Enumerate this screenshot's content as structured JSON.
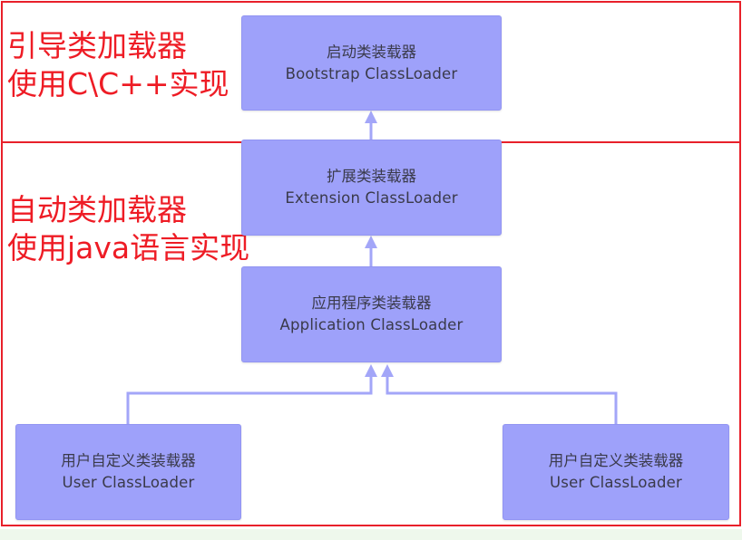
{
  "annotations": {
    "bootstrap_line1": "引导类加载器",
    "bootstrap_line2": "使用C\\C++实现",
    "custom_line1": "自动类加载器",
    "custom_line2": "使用java语言实现"
  },
  "loaders": {
    "bootstrap": {
      "zh": "启动类装载器",
      "en": "Bootstrap ClassLoader"
    },
    "extension": {
      "zh": "扩展类装载器",
      "en": "Extension ClassLoader"
    },
    "application": {
      "zh": "应用程序类装载器",
      "en": "Application ClassLoader"
    },
    "user_left": {
      "zh": "用户自定义类装载器",
      "en": "User ClassLoader"
    },
    "user_right": {
      "zh": "用户自定义类装载器",
      "en": "User ClassLoader"
    }
  },
  "colors": {
    "box_fill": "#9ea1fa",
    "arrow": "#9ea1fa",
    "frame": "#e8202a",
    "annotation_text": "#ee1c25"
  }
}
